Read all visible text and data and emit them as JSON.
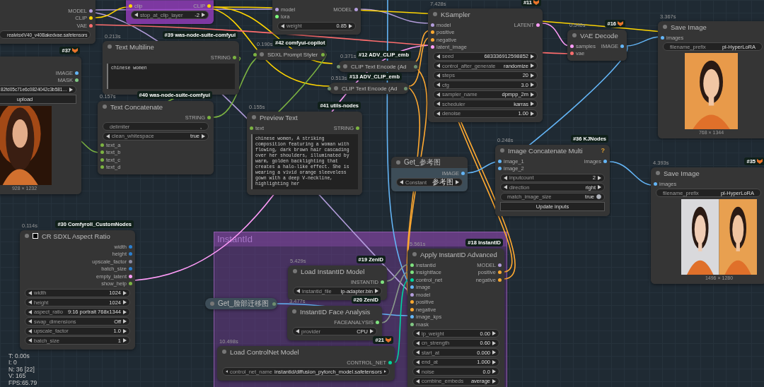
{
  "group": {
    "title": "InstantId"
  },
  "nodes": [
    {
      "kind": "node",
      "outputs": [
        {
          "label": "MODEL",
          "color": "#b39ddb"
        },
        {
          "label": "CLIP",
          "color": "#ffd500"
        },
        {
          "label": "VAE",
          "color": "#ff6e6e"
        }
      ],
      "widgets": [
        {
          "kind": "combo",
          "value": "realvisxlV40_v40Bakedvae.safetensors"
        }
      ]
    },
    {
      "kind": "bypassed",
      "inputs": [
        {
          "label": "clip",
          "color": "#ffd500"
        }
      ],
      "outputs": [
        {
          "label": "CLIP",
          "color": "#ffd500"
        }
      ],
      "widgets": [
        {
          "kind": "combo",
          "label": "stop_at_clip_layer",
          "value": "-2"
        }
      ]
    },
    {
      "kind": "node",
      "inputs": [
        {
          "label": "model",
          "color": "#b39ddb"
        },
        {
          "label": "lora",
          "color": "#7cfc7c"
        }
      ],
      "outputs": [
        {
          "label": "MODEL",
          "color": "#b39ddb"
        }
      ],
      "widgets": [
        {
          "kind": "combo",
          "label": "weight",
          "value": "0.85"
        }
      ]
    },
    {
      "kind": "node",
      "time": "7.428s",
      "badge": "#11",
      "badge_icon": true,
      "title": "KSampler",
      "inputs": [
        {
          "label": "model",
          "color": "#b39ddb"
        },
        {
          "label": "positive",
          "color": "#ffa931"
        },
        {
          "label": "negative",
          "color": "#ffa931"
        },
        {
          "label": "latent_image",
          "color": "#ff9cf9"
        }
      ],
      "outputs": [
        {
          "label": "LATENT",
          "color": "#ff9cf9"
        }
      ],
      "widgets": [
        {
          "kind": "combo",
          "label": "seed",
          "value": "683336912598852"
        },
        {
          "kind": "combo",
          "label": "control_after_generate",
          "value": "randomize"
        },
        {
          "kind": "combo",
          "label": "steps",
          "value": "20"
        },
        {
          "kind": "combo",
          "label": "cfg",
          "value": "3.0"
        },
        {
          "kind": "combo",
          "label": "sampler_name",
          "value": "dpmpp_2m"
        },
        {
          "kind": "combo",
          "label": "scheduler",
          "value": "karras"
        },
        {
          "kind": "combo",
          "label": "denoise",
          "value": "1.00"
        }
      ]
    },
    {
      "kind": "node",
      "time": "0.540s",
      "badge": "#16",
      "badge_icon": true,
      "title": "VAE Decode",
      "inputs": [
        {
          "label": "samples",
          "color": "#ff9cf9"
        },
        {
          "label": "vae",
          "color": "#ff6e6e"
        }
      ],
      "outputs": [
        {
          "label": "IMAGE",
          "color": "#64b5f6"
        }
      ]
    },
    {
      "kind": "node",
      "time": "3.367s",
      "title": "Save Image",
      "inputs": [
        {
          "label": "images",
          "color": "#64b5f6"
        }
      ],
      "widgets": [
        {
          "kind": "text",
          "label": "filename_prefix",
          "value": "pl-HyperLoRA"
        }
      ],
      "preview": {
        "kind": "picture",
        "caption": "768 × 1344"
      }
    },
    {
      "kind": "node",
      "badge": "#37",
      "badge_icon": true,
      "outputs": [
        {
          "label": "IMAGE",
          "color": "#64b5f6"
        },
        {
          "label": "MASK",
          "color": "#81c784"
        }
      ],
      "widgets": [
        {
          "kind": "combo",
          "value": "82fd05c71e6c0824042c3b581…"
        },
        {
          "kind": "button",
          "value": "upload"
        }
      ],
      "preview": {
        "kind": "picture",
        "caption": "928 × 1232"
      }
    },
    {
      "kind": "node",
      "time": "0.213s",
      "badge": "#39 was-node-suite-comfyui",
      "title": "Text Multiline",
      "outputs": [
        {
          "label": "STRING",
          "color": "#7cb342"
        }
      ],
      "widgets": [
        {
          "kind": "textarea",
          "value": "chinese women"
        }
      ]
    },
    {
      "kind": "node",
      "time": "0.157s",
      "badge": "#40 was-node-suite-comfyui",
      "title": "Text Concatenate",
      "outputs": [
        {
          "label": "STRING",
          "color": "#7cb342"
        }
      ],
      "widgets": [
        {
          "kind": "text",
          "label": "delimiter",
          "value": ","
        },
        {
          "kind": "combo",
          "label": "clean_whitespace",
          "value": "true"
        }
      ],
      "late_inputs": [
        {
          "label": "text_a",
          "color": "#7cb342"
        },
        {
          "label": "text_b",
          "color": "#7cb342"
        },
        {
          "label": "text_c",
          "color": "#7cb342"
        },
        {
          "label": "text_d",
          "color": "#7cb342"
        }
      ]
    },
    {
      "kind": "collapsed",
      "time": "0.190s",
      "badge": "#42 comfyui-copilot",
      "title": "SDXL Prompt Styler",
      "inputs": [
        {
          "color": "#7cb342"
        }
      ],
      "outputs": [
        {
          "color": "#7cb342"
        }
      ]
    },
    {
      "kind": "collapsed",
      "time": "0.371s",
      "badge": "#12 ADV_CLIP_emb",
      "title": "CLIP Text Encode (Ad",
      "inputs": [
        {
          "color": "#6f8f6f"
        }
      ],
      "outputs": [
        {
          "color": "#6f8f6f"
        }
      ]
    },
    {
      "kind": "collapsed",
      "time": "0.513s",
      "badge": "#13 ADV_CLIP_emb",
      "title": "CLIP Text Encode (Ad",
      "inputs": [
        {
          "color": "#6f8f6f"
        }
      ],
      "outputs": [
        {
          "color": "#6f8f6f"
        }
      ]
    },
    {
      "kind": "node",
      "time": "0.155s",
      "badge": "#41 utils-nodes",
      "title": "Preview Text",
      "inputs": [
        {
          "label": "text",
          "color": "#7cb342"
        }
      ],
      "outputs": [
        {
          "label": "STRING",
          "color": "#7cb342"
        }
      ],
      "widgets": [
        {
          "kind": "textarea",
          "value": "chinese women, A striking composition featuring a woman with flowing, dark brown hair cascading over her shoulders, illuminated by warm, golden backlighting that creates a halo-like effect. She is wearing a vivid orange sleeveless gown with a deep V-neckline, highlighting her"
        }
      ]
    },
    {
      "kind": "getter",
      "title": "Get_参考图",
      "outputs": [
        {
          "label": "IMAGE",
          "color": "#64b5f6"
        }
      ],
      "widgets": [
        {
          "kind": "combo",
          "label": "Constant",
          "value": "参考图"
        }
      ]
    },
    {
      "kind": "node",
      "time": "0.248s",
      "badge": "#36 KJNodes",
      "help": "?",
      "title": "Image Concatenate Multi",
      "inputs": [
        {
          "label": "image_1",
          "color": "#64b5f6"
        },
        {
          "label": "image_2",
          "color": "#64b5f6"
        }
      ],
      "outputs": [
        {
          "label": "images",
          "color": "#64b5f6"
        }
      ],
      "widgets": [
        {
          "kind": "combo",
          "label": "inputcount",
          "value": "2"
        },
        {
          "kind": "combo",
          "label": "direction",
          "value": "right"
        },
        {
          "kind": "toggle",
          "label": "match_image_size",
          "value": "true",
          "on": true
        },
        {
          "kind": "button",
          "value": "Update inputs"
        }
      ]
    },
    {
      "kind": "node",
      "time": "4.393s",
      "badge": "#35",
      "badge_icon": true,
      "title": "Save Image",
      "inputs": [
        {
          "label": "images",
          "color": "#64b5f6"
        }
      ],
      "widgets": [
        {
          "kind": "text",
          "label": "filename_prefix",
          "value": "pl-HyperLoRA"
        }
      ],
      "preview": {
        "kind": "picture",
        "caption": "1496 × 1280"
      }
    },
    {
      "kind": "node",
      "time": "0.114s",
      "badge": "#30 Comfyroll_CustomNodes",
      "title_icon": true,
      "title": "CR SDXL Aspect Ratio",
      "outputs": [
        {
          "label": "width",
          "color": "#2a7fd0"
        },
        {
          "label": "height",
          "color": "#2a7fd0"
        },
        {
          "label": "upscale_factor",
          "color": "#8a8aa0"
        },
        {
          "label": "batch_size",
          "color": "#2a7fd0"
        },
        {
          "label": "empty_latent",
          "color": "#ff9cf9"
        },
        {
          "label": "show_help",
          "color": "#7cb342"
        }
      ],
      "widgets": [
        {
          "kind": "combo",
          "label": "width",
          "value": "1024"
        },
        {
          "kind": "combo",
          "label": "height",
          "value": "1024"
        },
        {
          "kind": "combo",
          "label": "aspect_ratio",
          "value": "9:16 portrait 768x1344"
        },
        {
          "kind": "combo",
          "label": "swap_dimensions",
          "value": "Off"
        },
        {
          "kind": "combo",
          "label": "upscale_factor",
          "value": "1.0"
        },
        {
          "kind": "combo",
          "label": "batch_size",
          "value": "1"
        }
      ]
    },
    {
      "kind": "node",
      "time": "5.429s",
      "badge": "#19 ZenID",
      "title": "Load InstantID Model",
      "outputs": [
        {
          "label": "INSTANTID",
          "color": "#7fe27f"
        }
      ],
      "widgets": [
        {
          "kind": "combo",
          "label": "instantid_file",
          "value": "ip-adapter.bin"
        }
      ]
    },
    {
      "kind": "collapsed-getter",
      "title": "Get_脸部迁移图",
      "outputs": [
        {
          "color": "#6f8f6f"
        }
      ]
    },
    {
      "kind": "node",
      "time": "3.477s",
      "badge": "#20 ZenID",
      "title": "InstantID Face Analysis",
      "outputs": [
        {
          "label": "FACEANALYSIS",
          "color": "#7fe27f"
        }
      ],
      "widgets": [
        {
          "kind": "combo",
          "label": "provider",
          "value": "CPU"
        }
      ]
    },
    {
      "kind": "node",
      "time": "10.498s",
      "badge": "#21",
      "badge_icon": true,
      "title": "Load ControlNet Model",
      "outputs": [
        {
          "label": "CONTROL_NET",
          "color": "#00d7a0"
        }
      ],
      "widgets": [
        {
          "kind": "combo",
          "label": "control_net_name",
          "value": "instantid/diffusion_pytorch_model.safetensors"
        }
      ]
    },
    {
      "kind": "node",
      "time": "5.561s",
      "badge": "#18 InstantID",
      "title": "Apply InstantID Advanced",
      "inputs": [
        {
          "label": "instantid",
          "color": "#7fe27f"
        },
        {
          "label": "insightface",
          "color": "#7fe27f"
        },
        {
          "label": "control_net",
          "color": "#00d7a0"
        },
        {
          "label": "image",
          "color": "#64b5f6"
        },
        {
          "label": "model",
          "color": "#b39ddb"
        },
        {
          "label": "positive",
          "color": "#ffa931"
        },
        {
          "label": "negative",
          "color": "#ffa931"
        },
        {
          "label": "image_kps",
          "color": "#64b5f6"
        },
        {
          "label": "mask",
          "color": "#81c784"
        }
      ],
      "outputs": [
        {
          "label": "MODEL",
          "color": "#b39ddb"
        },
        {
          "label": "positive",
          "color": "#ffa931"
        },
        {
          "label": "negative",
          "color": "#ffa931"
        }
      ],
      "widgets": [
        {
          "kind": "combo",
          "label": "ip_weight",
          "value": "0.00"
        },
        {
          "kind": "combo",
          "label": "cn_strength",
          "value": "0.60"
        },
        {
          "kind": "combo",
          "label": "start_at",
          "value": "0.000"
        },
        {
          "kind": "combo",
          "label": "end_at",
          "value": "1.000"
        },
        {
          "kind": "combo",
          "label": "noise",
          "value": "0.0"
        },
        {
          "kind": "combo",
          "label": "combine_embeds",
          "value": "average"
        }
      ]
    }
  ],
  "stats": [
    "T: 0.00s",
    "I: 0",
    "N: 36 [22]",
    "V: 165",
    "FPS:65.79"
  ]
}
